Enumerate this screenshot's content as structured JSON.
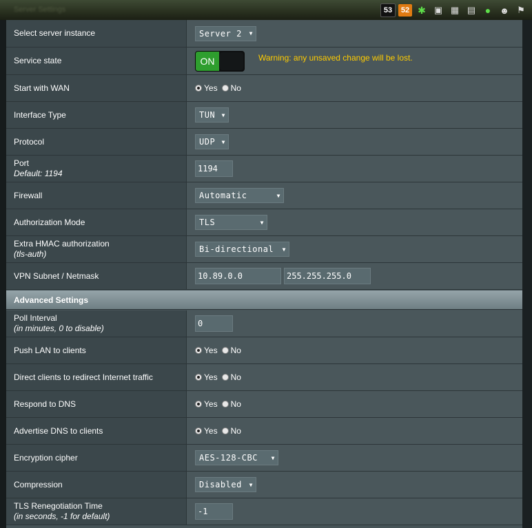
{
  "window": {
    "title": "Server Settings"
  },
  "tray": [
    "53",
    "52"
  ],
  "rows": {
    "server_instance": {
      "label": "Select server instance",
      "value": "Server 2"
    },
    "service_state": {
      "label": "Service state",
      "toggle": "ON",
      "warning": "Warning: any unsaved change will be lost."
    },
    "start_wan": {
      "label": "Start with WAN",
      "yes": "Yes",
      "no": "No",
      "selected": "Yes"
    },
    "interface_type": {
      "label": "Interface Type",
      "value": "TUN"
    },
    "protocol": {
      "label": "Protocol",
      "value": "UDP"
    },
    "port": {
      "label": "Port",
      "sublabel": "Default: 1194",
      "value": "1194"
    },
    "firewall": {
      "label": "Firewall",
      "value": "Automatic"
    },
    "auth_mode": {
      "label": "Authorization Mode",
      "value": "TLS"
    },
    "hmac": {
      "label": "Extra HMAC authorization",
      "sublabel": "(tls-auth)",
      "value": "Bi-directional"
    },
    "subnet": {
      "label": "VPN Subnet / Netmask",
      "subnet": "10.89.0.0",
      "netmask": "255.255.255.0"
    }
  },
  "advanced": {
    "title": "Advanced Settings",
    "poll": {
      "label": "Poll Interval",
      "sublabel": "(in minutes, 0 to disable)",
      "value": "0"
    },
    "push_lan": {
      "label": "Push LAN to clients",
      "yes": "Yes",
      "no": "No",
      "selected": "Yes"
    },
    "redirect": {
      "label": "Direct clients to redirect Internet traffic",
      "yes": "Yes",
      "no": "No",
      "selected": "Yes"
    },
    "respond_dns": {
      "label": "Respond to DNS",
      "yes": "Yes",
      "no": "No",
      "selected": "Yes"
    },
    "advertise_dns": {
      "label": "Advertise DNS to clients",
      "yes": "Yes",
      "no": "No",
      "selected": "Yes"
    },
    "cipher": {
      "label": "Encryption cipher",
      "value": "AES-128-CBC"
    },
    "compression": {
      "label": "Compression",
      "value": "Disabled"
    },
    "tls_reneg": {
      "label": "TLS Renegotiation Time",
      "sublabel": "(in seconds, -1 for default)",
      "value": "-1"
    }
  },
  "colors": {
    "warning": "#ffcc00",
    "toggle_on": "#2e9e2e",
    "panel": "#475458",
    "section_header": "#8697a0"
  }
}
